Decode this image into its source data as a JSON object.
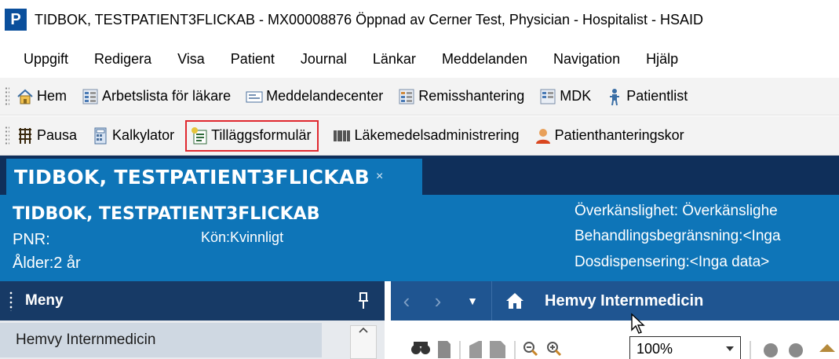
{
  "window": {
    "app_logo": "P",
    "title": "TIDBOK, TESTPATIENT3FLICKAB - MX00008876 Öppnad av Cerner Test, Physician - Hospitalist - HSAID"
  },
  "menubar": {
    "items": [
      "Uppgift",
      "Redigera",
      "Visa",
      "Patient",
      "Journal",
      "Länkar",
      "Meddelanden",
      "Navigation",
      "Hjälp"
    ]
  },
  "toolbar1": {
    "items": [
      {
        "label": "Hem",
        "icon": "home-icon"
      },
      {
        "label": "Arbetslista för läkare",
        "icon": "worklist-icon"
      },
      {
        "label": "Meddelandecenter",
        "icon": "message-center-icon"
      },
      {
        "label": "Remisshantering",
        "icon": "referral-icon"
      },
      {
        "label": "MDK",
        "icon": "mdk-icon"
      },
      {
        "label": "Patientlist",
        "icon": "patient-list-icon"
      }
    ]
  },
  "toolbar2": {
    "items": [
      {
        "label": "Pausa",
        "icon": "pause-icon"
      },
      {
        "label": "Kalkylator",
        "icon": "calculator-icon"
      },
      {
        "label": "Tilläggsformulär",
        "icon": "addon-form-icon"
      },
      {
        "label": "Läkemedelsadministrering",
        "icon": "barcode-icon"
      },
      {
        "label": "Patienthanteringskor",
        "icon": "person-icon"
      }
    ]
  },
  "patient_tab": {
    "title": "TIDBOK, TESTPATIENT3FLICKAB",
    "close": "×"
  },
  "banner": {
    "name": "TIDBOK, TESTPATIENT3FLICKAB",
    "pnr": "PNR:",
    "kon": "Kön:Kvinnligt",
    "alder": "Ålder:2 år",
    "overkanslighet": "Överkänslighet: Överkänslighe",
    "behandling": "Behandlingsbegränsning:<Inga",
    "dosdispensering": "Dosdispensering:<Inga data>"
  },
  "left_menu": {
    "title": "Meny",
    "selected_item": "Hemvy Internmedicin"
  },
  "content": {
    "title": "Hemvy Internmedicin",
    "zoom": "100%"
  },
  "colors": {
    "banner_blue": "#0e75b8",
    "tabstrip_navy": "#0f2f5a",
    "nav_blue": "#1f5591",
    "highlight_red": "#e0282f"
  }
}
